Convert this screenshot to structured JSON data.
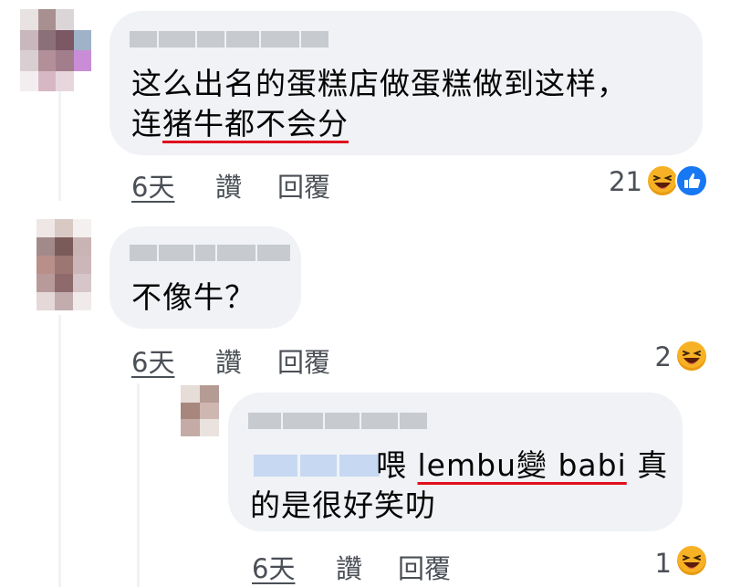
{
  "comments": [
    {
      "text_line1": "这么出名的蛋糕店做蛋糕做到这样，",
      "text_line2_prefix": "连",
      "text_line2_underlined": "猪牛都不会分",
      "time": "6天",
      "like": "讚",
      "reply": "回覆",
      "reaction_count": "21",
      "reactions": [
        "haha-icon",
        "like-icon"
      ]
    },
    {
      "text_line1": "不像牛？",
      "time": "6天",
      "like": "讚",
      "reply": "回覆",
      "reaction_count": "2",
      "reactions": [
        "haha-icon"
      ]
    },
    {
      "text_line1_prefix": "喂 ",
      "text_line1_underlined": "lembu變 babi",
      "text_line1_suffix": " 真",
      "text_line2": "的是很好笑叻",
      "time": "6天",
      "like": "讚",
      "reply": "回覆",
      "reaction_count": "1",
      "reactions": [
        "haha-icon"
      ]
    }
  ],
  "colors": {
    "bubble": "#f0f2f5",
    "underline": "#e0101e",
    "meta_text": "#4b4f56",
    "like_blue": "#1877f2",
    "haha_yellow": "#f7b125"
  }
}
